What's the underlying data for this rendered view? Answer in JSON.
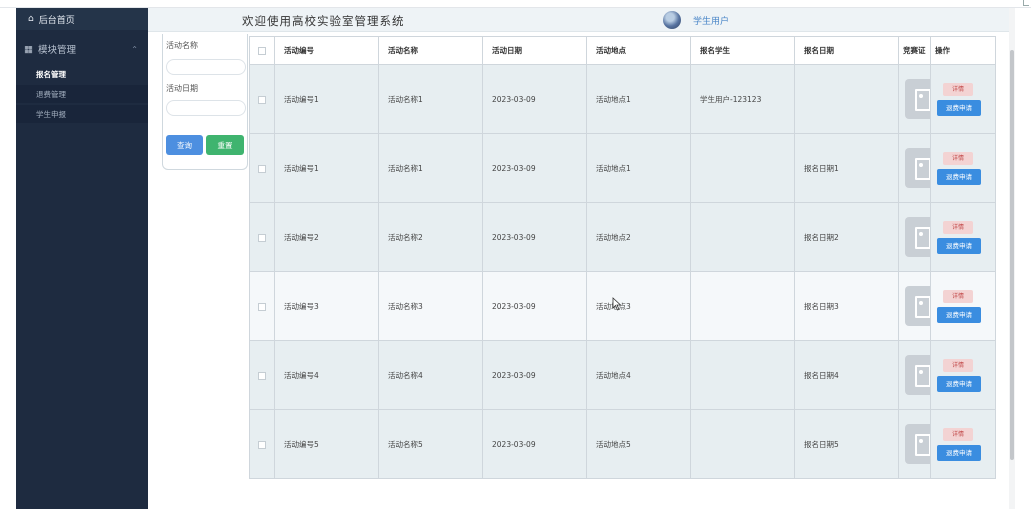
{
  "sidebar": {
    "home_label": "后台首页",
    "group_label": "模块管理",
    "items": [
      {
        "label": "报名管理"
      },
      {
        "label": "退费管理"
      },
      {
        "label": "学生申报"
      }
    ]
  },
  "header": {
    "title": "欢迎使用高校实验室管理系统",
    "user": "学生用户"
  },
  "search": {
    "activity_name_label": "活动名称",
    "activity_date_label": "活动日期",
    "query_button": "查询",
    "reset_button": "重置"
  },
  "table": {
    "columns": [
      "活动编号",
      "活动名称",
      "活动日期",
      "活动地点",
      "报名学生",
      "报名日期",
      "竞赛证",
      "操作"
    ],
    "rows": [
      {
        "code": "活动编号1",
        "name": "活动名称1",
        "date": "2023-03-09",
        "place": "活动地点1",
        "student": "学生用户-123123",
        "signup_date": ""
      },
      {
        "code": "活动编号1",
        "name": "活动名称1",
        "date": "2023-03-09",
        "place": "活动地点1",
        "student": "",
        "signup_date": "报名日期1"
      },
      {
        "code": "活动编号2",
        "name": "活动名称2",
        "date": "2023-03-09",
        "place": "活动地点2",
        "student": "",
        "signup_date": "报名日期2"
      },
      {
        "code": "活动编号3",
        "name": "活动名称3",
        "date": "2023-03-09",
        "place": "活动地点3",
        "student": "",
        "signup_date": "报名日期3"
      },
      {
        "code": "活动编号4",
        "name": "活动名称4",
        "date": "2023-03-09",
        "place": "活动地点4",
        "student": "",
        "signup_date": "报名日期4"
      },
      {
        "code": "活动编号5",
        "name": "活动名称5",
        "date": "2023-03-09",
        "place": "活动地点5",
        "student": "",
        "signup_date": "报名日期5"
      }
    ],
    "detail_button": "详情",
    "refund_button": "退费申请"
  },
  "colors": {
    "sidebar_bg": "#1e2b40",
    "header_bg": "#eef3f6",
    "primary": "#3a8de0",
    "success": "#3fb46f",
    "danger_soft": "#f3d3d3"
  }
}
